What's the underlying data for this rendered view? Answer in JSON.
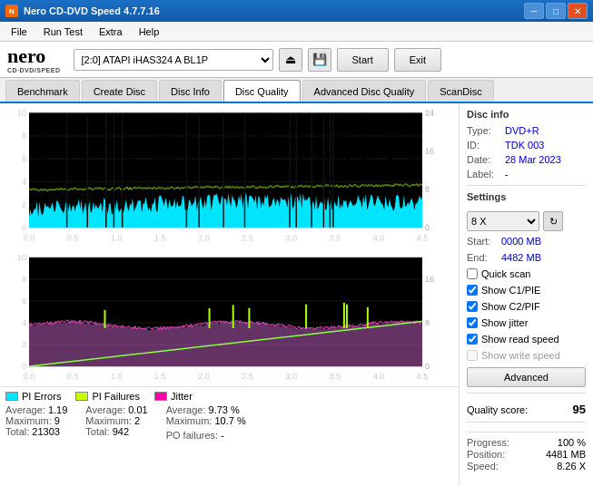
{
  "window": {
    "title": "Nero CD-DVD Speed 4.7.7.16",
    "controls": [
      "minimize",
      "maximize",
      "close"
    ]
  },
  "menu": {
    "items": [
      "File",
      "Run Test",
      "Extra",
      "Help"
    ]
  },
  "toolbar": {
    "drive_value": "[2:0]  ATAPI iHAS324  A BL1P",
    "start_label": "Start",
    "exit_label": "Exit"
  },
  "tabs": {
    "items": [
      "Benchmark",
      "Create Disc",
      "Disc Info",
      "Disc Quality",
      "Advanced Disc Quality",
      "ScanDisc"
    ],
    "active": "Disc Quality"
  },
  "disc_info": {
    "section_title": "Disc info",
    "type_label": "Type:",
    "type_value": "DVD+R",
    "id_label": "ID:",
    "id_value": "TDK 003",
    "date_label": "Date:",
    "date_value": "28 Mar 2023",
    "label_label": "Label:",
    "label_value": "-"
  },
  "settings": {
    "section_title": "Settings",
    "speed_value": "8 X",
    "start_label": "Start:",
    "start_value": "0000 MB",
    "end_label": "End:",
    "end_value": "4482 MB",
    "quick_scan_label": "Quick scan",
    "quick_scan_checked": false,
    "c1pie_label": "Show C1/PIE",
    "c1pie_checked": true,
    "c2pif_label": "Show C2/PIF",
    "c2pif_checked": true,
    "jitter_label": "Show jitter",
    "jitter_checked": true,
    "read_speed_label": "Show read speed",
    "read_speed_checked": true,
    "write_speed_label": "Show write speed",
    "write_speed_checked": false,
    "write_speed_disabled": true,
    "advanced_label": "Advanced"
  },
  "quality": {
    "score_label": "Quality score:",
    "score_value": "95"
  },
  "progress": {
    "progress_label": "Progress:",
    "progress_value": "100 %",
    "position_label": "Position:",
    "position_value": "4481 MB",
    "speed_label": "Speed:",
    "speed_value": "8.26 X"
  },
  "legend": {
    "pi_errors_label": "PI Errors",
    "pi_errors_color": "#00e5ff",
    "pi_failures_label": "PI Failures",
    "pi_failures_color": "#c8ff00",
    "jitter_label": "Jitter",
    "jitter_color": "#ff00aa"
  },
  "stats": {
    "pi_errors": {
      "avg_label": "Average:",
      "avg_value": "1.19",
      "max_label": "Maximum:",
      "max_value": "9",
      "total_label": "Total:",
      "total_value": "21303"
    },
    "pi_failures": {
      "avg_label": "Average:",
      "avg_value": "0.01",
      "max_label": "Maximum:",
      "max_value": "2",
      "total_label": "Total:",
      "total_value": "942"
    },
    "jitter": {
      "avg_label": "Average:",
      "avg_value": "9.73 %",
      "max_label": "Maximum:",
      "max_value": "10.7 %"
    },
    "po_failures_label": "PO failures:",
    "po_failures_value": "-"
  }
}
